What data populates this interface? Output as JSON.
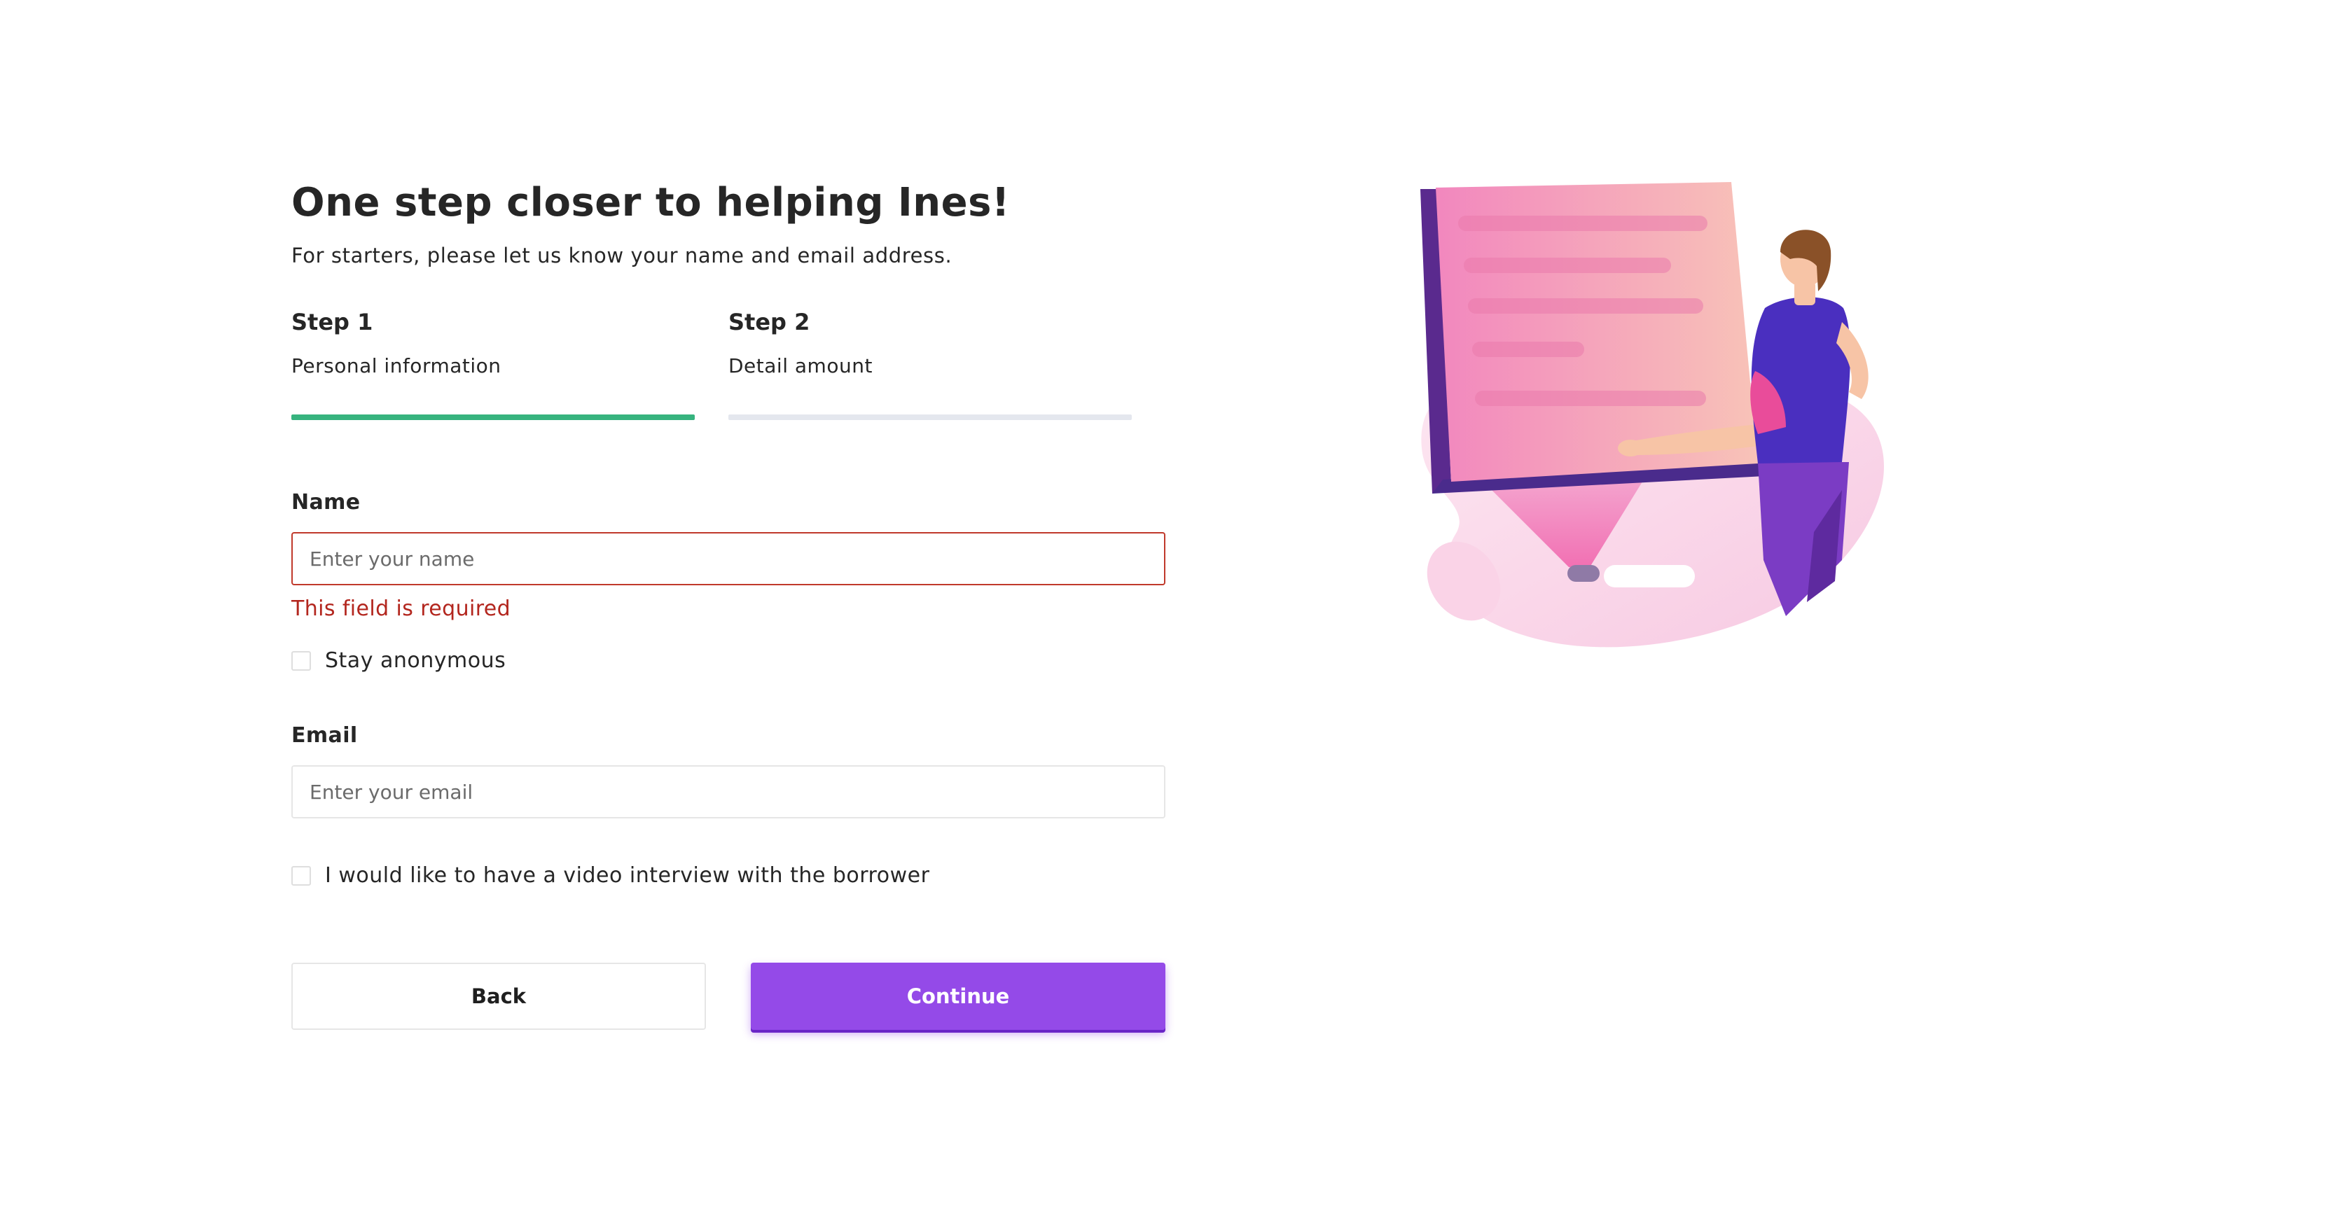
{
  "header": {
    "title": "One step closer to helping Ines!",
    "subtitle": "For starters, please let us know your name and email address."
  },
  "steps": [
    {
      "number": "Step 1",
      "label": "Personal information",
      "active": true
    },
    {
      "number": "Step 2",
      "label": "Detail amount",
      "active": false
    }
  ],
  "form": {
    "name": {
      "label": "Name",
      "placeholder": "Enter your name",
      "value": "",
      "error": "This field is required"
    },
    "stay_anonymous": {
      "label": "Stay anonymous",
      "checked": false
    },
    "email": {
      "label": "Email",
      "placeholder": "Enter your email",
      "value": ""
    },
    "video_interview": {
      "label": "I would like to have a video interview with the borrower",
      "checked": false
    }
  },
  "actions": {
    "back_label": "Back",
    "continue_label": "Continue"
  },
  "colors": {
    "accent": "#944ae8",
    "step_active": "#36b37e",
    "step_inactive": "#e4e7ee",
    "error": "#b3261e"
  },
  "illustration": {
    "icon": "person-presenting-board-illustration"
  }
}
